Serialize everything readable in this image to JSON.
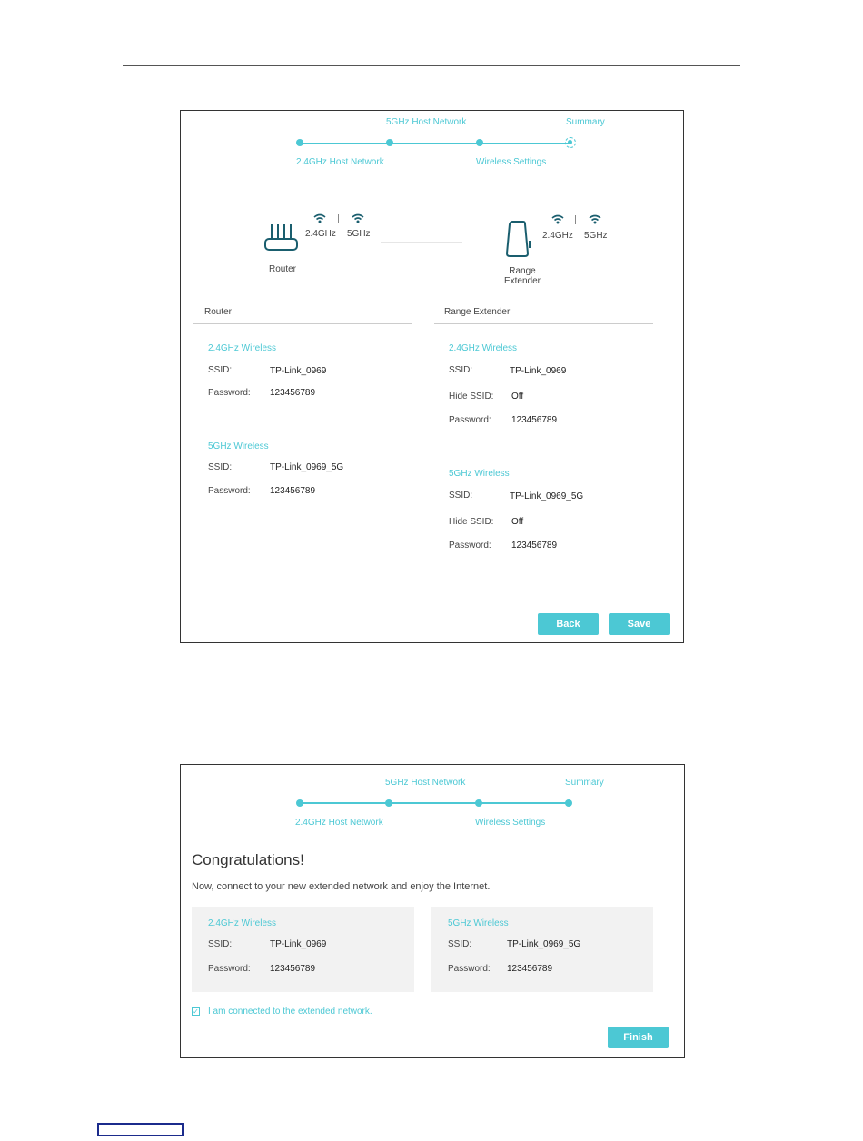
{
  "steps": {
    "host24": "2.4GHz Host Network",
    "host5": "5GHz Host Network",
    "wireless": "Wireless Settings",
    "summary": "Summary"
  },
  "diagram": {
    "router_label": "Router",
    "extender_label_line1": "Range",
    "extender_label_line2": "Extender",
    "band24": "2.4GHz",
    "band5": "5GHz"
  },
  "summary_page": {
    "router_heading": "Router",
    "extender_heading": "Range Extender",
    "router": {
      "w24_title": "2.4GHz Wireless",
      "w24_ssid_label": "SSID:",
      "w24_ssid": "TP-Link_0969",
      "w24_pw_label": "Password:",
      "w24_pw": "123456789",
      "w5_title": "5GHz Wireless",
      "w5_ssid_label": "SSID:",
      "w5_ssid": "TP-Link_0969_5G",
      "w5_pw_label": "Password:",
      "w5_pw": "123456789"
    },
    "extender": {
      "w24_title": "2.4GHz Wireless",
      "w24_ssid_label": "SSID:",
      "w24_ssid": "TP-Link_0969",
      "w24_hide_label": "Hide SSID:",
      "w24_hide": "Off",
      "w24_pw_label": "Password:",
      "w24_pw": "123456789",
      "w5_title": "5GHz Wireless",
      "w5_ssid_label": "SSID:",
      "w5_ssid": "TP-Link_0969_5G",
      "w5_hide_label": "Hide SSID:",
      "w5_hide": "Off",
      "w5_pw_label": "Password:",
      "w5_pw": "123456789"
    },
    "back_button": "Back",
    "save_button": "Save"
  },
  "finish_page": {
    "title": "Congratulations!",
    "subtitle": "Now, connect to your new extended network and enjoy the Internet.",
    "card24": {
      "title": "2.4GHz Wireless",
      "ssid_label": "SSID:",
      "ssid": "TP-Link_0969",
      "pw_label": "Password:",
      "pw": "123456789"
    },
    "card5": {
      "title": "5GHz Wireless",
      "ssid_label": "SSID:",
      "ssid": "TP-Link_0969_5G",
      "pw_label": "Password:",
      "pw": "123456789"
    },
    "checkbox_label": "I am connected to the extended network.",
    "checkbox_checked": true,
    "finish_button": "Finish"
  },
  "colors": {
    "accent": "#4cc8d4",
    "icon_dark": "#1a5e6e"
  }
}
